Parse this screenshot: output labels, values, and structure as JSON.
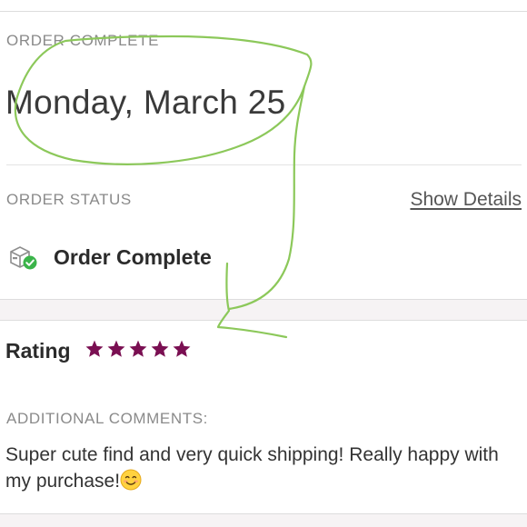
{
  "order": {
    "complete_label": "ORDER COMPLETE",
    "date": "Monday, March 25",
    "status_label": "ORDER STATUS",
    "show_details": "Show Details",
    "status_text": "Order Complete"
  },
  "rating": {
    "label": "Rating",
    "stars_filled": 5,
    "stars_total": 5,
    "star_color": "#7a0f52"
  },
  "comments": {
    "label": "ADDITIONAL COMMENTS:",
    "text": "Super cute find and very quick shipping! Really happy with my purchase!"
  },
  "annotation": {
    "color": "#8cc85a"
  },
  "icons": {
    "status": "package-check-icon",
    "star": "star-icon",
    "emoji": "smiling-face-emoji-icon"
  },
  "colors": {
    "success": "#3bb44a",
    "muted_text": "#8a8a8a"
  }
}
